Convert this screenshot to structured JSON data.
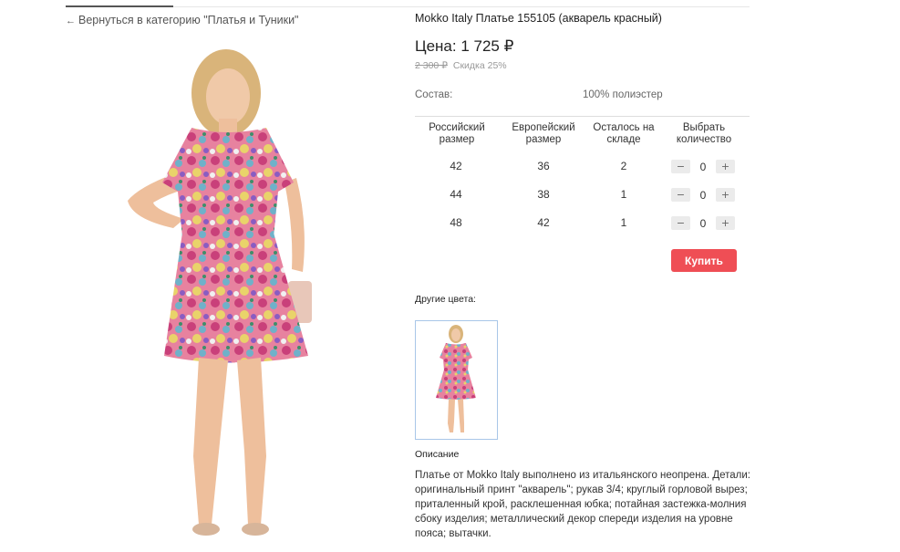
{
  "nav": {
    "back_arrow": "←",
    "back_label": "Вернуться в категорию \"Платья и Туники\""
  },
  "product": {
    "title": "Mokko Italy Платье 155105 (акварель красный)",
    "price": "Цена: 1 725 ₽",
    "old_price": "2 300 ₽",
    "discount": "Скидка 25%",
    "composition_label": "Состав:",
    "composition_value": "100% полиэстер"
  },
  "sizes": {
    "headers": [
      "Российский размер",
      "Европейский размер",
      "Осталось на складе",
      "Выбрать количество"
    ],
    "rows": [
      {
        "ru": "42",
        "eu": "36",
        "stock": "2",
        "qty": "0"
      },
      {
        "ru": "44",
        "eu": "38",
        "stock": "1",
        "qty": "0"
      },
      {
        "ru": "48",
        "eu": "42",
        "stock": "1",
        "qty": "0"
      }
    ],
    "minus": "−",
    "plus": "+"
  },
  "buy_label": "Купить",
  "other_colors_label": "Другие цвета:",
  "description": {
    "title": "Описание",
    "text": "Платье от Mokko Italy выполнено из итальянского неопрена. Детали: оригинальный принт \"акварель\"; рукав 3/4; круглый горловой вырез; приталенный крой, расклешенная юбка; потайная застежка-молния сбоку изделия; металлический декор спереди изделия на уровне пояса; вытачки."
  },
  "colors": {
    "accent": "#ef4e55",
    "thumb_border": "#a8c6e8"
  }
}
